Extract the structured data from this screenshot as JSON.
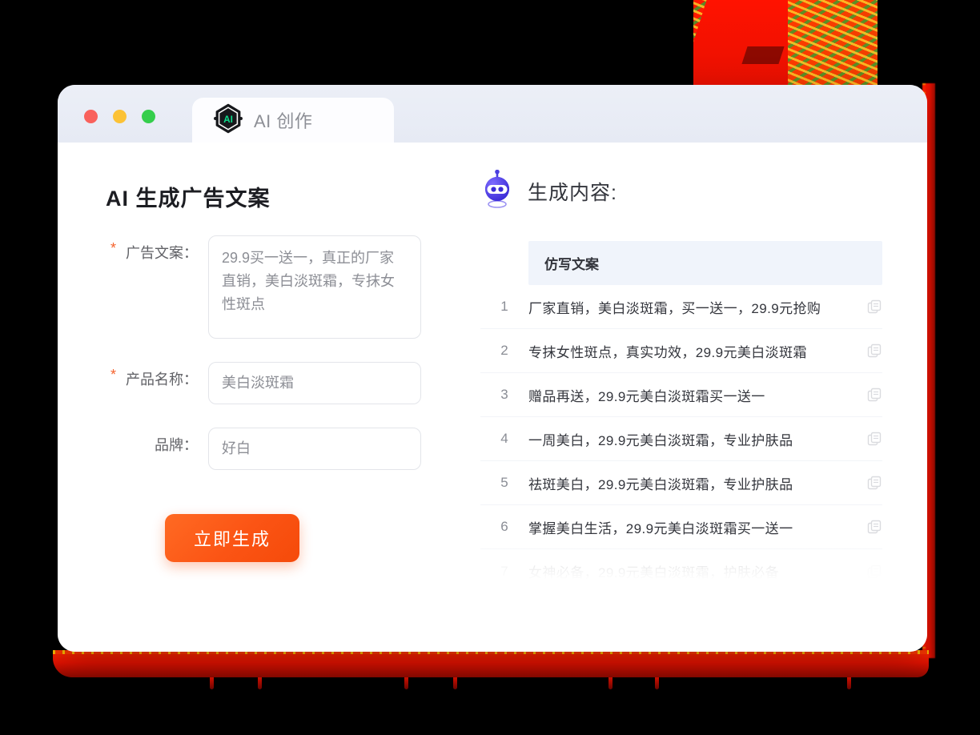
{
  "window": {
    "traffic_lights": [
      "close",
      "minimize",
      "maximize"
    ],
    "tab": {
      "label": "AI 创作",
      "icon": "ai-hexagon-logo-icon",
      "logo_text": "AI"
    }
  },
  "form": {
    "title": "AI 生成广告文案",
    "fields": [
      {
        "label": "广告文案：",
        "required": true,
        "type": "textarea",
        "value": "29.9买一送一，真正的厂家直销，美白淡斑霜，专抹女性斑点"
      },
      {
        "label": "产品名称：",
        "required": true,
        "type": "text",
        "value": "美白淡斑霜"
      },
      {
        "label": "品牌：",
        "required": false,
        "type": "text",
        "value": "好白"
      }
    ],
    "submit_label": "立即生成"
  },
  "result": {
    "icon": "robot-head-icon",
    "title": "生成内容:",
    "column_header": "仿写文案",
    "rows": [
      {
        "num": "1",
        "text": "厂家直销，美白淡斑霜，买一送一，29.9元抢购"
      },
      {
        "num": "2",
        "text": "专抹女性斑点，真实功效，29.9元美白淡斑霜"
      },
      {
        "num": "3",
        "text": "赠品再送，29.9元美白淡斑霜买一送一"
      },
      {
        "num": "4",
        "text": "一周美白，29.9元美白淡斑霜，专业护肤品"
      },
      {
        "num": "5",
        "text": "祛斑美白，29.9元美白淡斑霜，专业护肤品"
      },
      {
        "num": "6",
        "text": "掌握美白生活，29.9元美白淡斑霜买一送一"
      },
      {
        "num": "7",
        "text": "女神必备，29.9元美白淡斑霜，护肤必备"
      }
    ],
    "row_action_icon": "copy-icon"
  },
  "colors": {
    "accent_orange": "#fb5414",
    "decoration_red": "#e81000",
    "logo_green": "#0ddc8c",
    "robot_blue": "#4b3fe0",
    "table_header_bg": "#f0f4fb",
    "traffic_red": "#f9615c",
    "traffic_yellow": "#fcc236",
    "traffic_green": "#35ce4c"
  }
}
